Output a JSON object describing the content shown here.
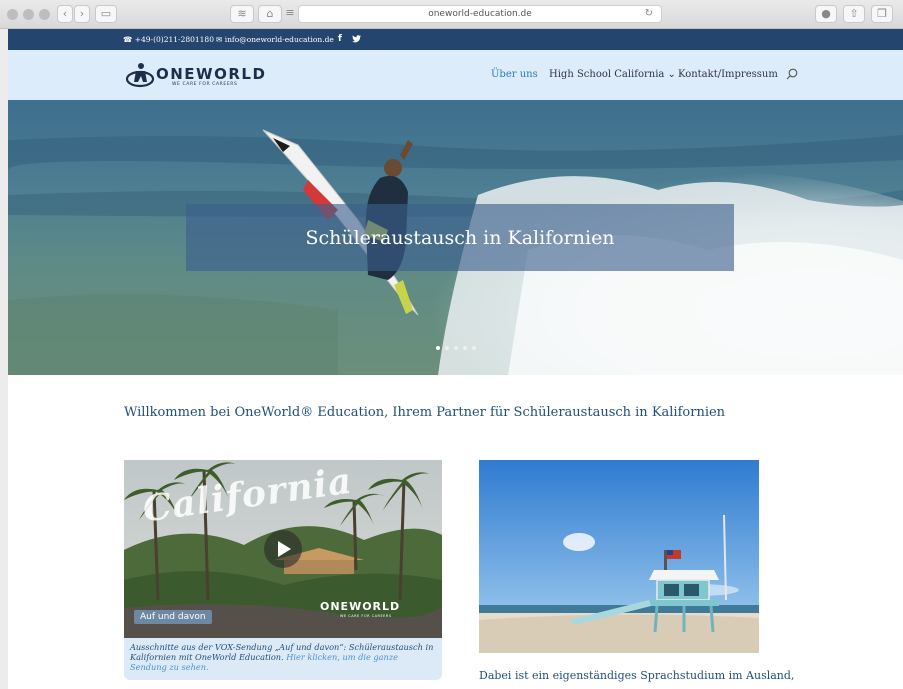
{
  "browser": {
    "url": "oneworld-education.de"
  },
  "contact": {
    "phone": "+49-(0)211-2801180",
    "email": "info@oneworld-education.de",
    "facebook": "f",
    "twitter": "t"
  },
  "logo": {
    "wordmark": "ONEWORLD",
    "tagline": "WE CARE FOR CAREERS"
  },
  "nav": {
    "items": [
      {
        "label": "Über uns"
      },
      {
        "label": "High School California ⌄"
      },
      {
        "label": "Kontakt/Impressum"
      }
    ]
  },
  "hero": {
    "title": "Schüleraustausch in Kalifornien",
    "slides": 5,
    "active_slide": 1
  },
  "main": {
    "welcome": "Willkommen bei OneWorld® Education, Ihrem Partner für Schüleraustausch in Kalifornien",
    "video": {
      "overlay_title": "California",
      "show_logo": "Auf und davon",
      "logo": "ONEWORLD",
      "logo_tag": "WE CARE FOR CAREERS"
    },
    "caption_text": "Ausschnitte aus der VOX-Sendung „Auf und davon“: Schüleraustausch in Kalifornien mit OneWorld Education.",
    "caption_link": "Hier klicken, um die ganze Sendung zu sehen.",
    "body_text": "Dabei ist ein eigenständiges Sprachstudium im Ausland,"
  },
  "colors": {
    "contact_bar": "#24466e",
    "header": "#dcecfa",
    "accent": "#2a7dbd",
    "text": "#1f4e7a"
  }
}
